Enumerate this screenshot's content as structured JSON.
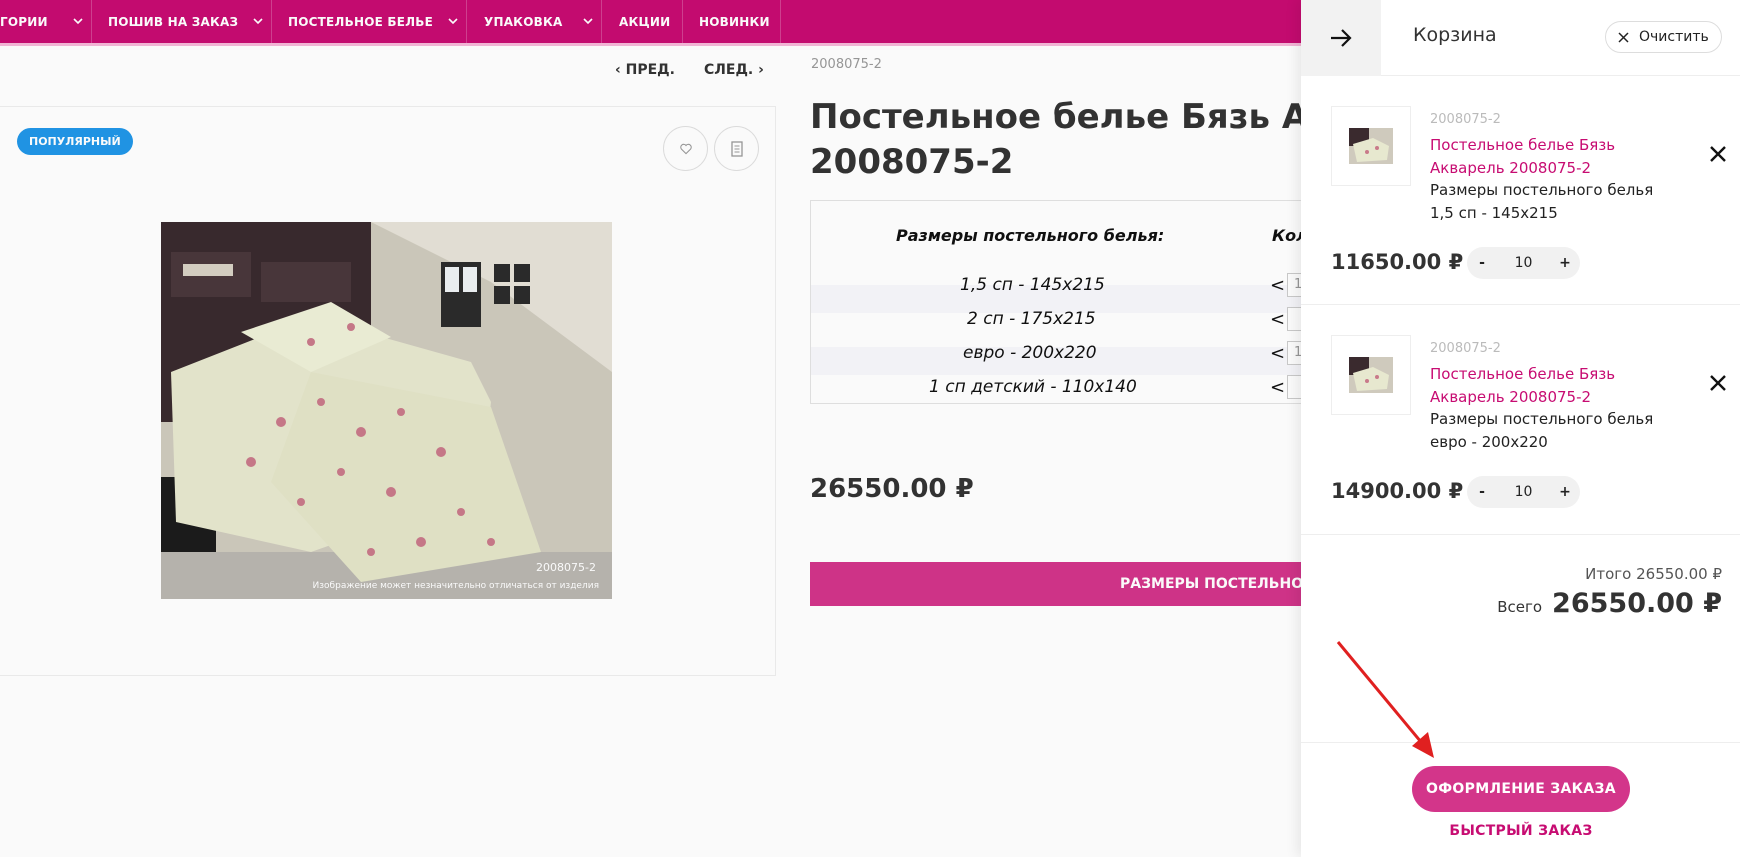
{
  "nav": {
    "items": [
      {
        "label": "ГОРИИ"
      },
      {
        "label": "ПОШИВ НА ЗАКАЗ"
      },
      {
        "label": "ПОСТЕЛЬНОЕ БЕЛЬЕ"
      },
      {
        "label": "УПАКОВКА"
      },
      {
        "label": "АКЦИИ"
      },
      {
        "label": "НОВИНКИ"
      }
    ]
  },
  "pager": {
    "prev": "‹ ПРЕД.",
    "next": "СЛЕД. ›"
  },
  "product": {
    "badge": "ПОПУЛЯРНЫЙ",
    "sku": "2008075-2",
    "title_line1": "Постельное белье Бязь Аква",
    "title_line2": "2008075-2",
    "image_caption": "2008075-2",
    "image_note": "Изображение может незначительно отличаться от изделия",
    "sizes_header": "Размеры постельного белья:",
    "qty_header": "Кол",
    "sizes": [
      {
        "name": "1,5 сп - 145х215",
        "lt": "<",
        "qty": "1"
      },
      {
        "name": "2 сп - 175х215",
        "lt": "<",
        "qty": ""
      },
      {
        "name": "евро - 200х220",
        "lt": "<",
        "qty": "1"
      },
      {
        "name": "1 сп детский - 110х140",
        "lt": "<",
        "qty": ""
      }
    ],
    "price": "26550.00 ₽",
    "sizes_button": "РАЗМЕРЫ ПОСТЕЛЬНОГО"
  },
  "cart": {
    "title": "Корзина",
    "clear_label": "Очистить",
    "items": [
      {
        "sku": "2008075-2",
        "name": "Постельное белье Бязь Акварель 2008075-2",
        "desc": "Размеры постельного белья 1,5 сп - 145х215",
        "price": "11650.00 ₽",
        "minus": "-",
        "qty": "10",
        "plus": "+"
      },
      {
        "sku": "2008075-2",
        "name": "Постельное белье Бязь Акварель 2008075-2",
        "desc": "Размеры постельного белья евро - 200х220",
        "price": "14900.00 ₽",
        "minus": "-",
        "qty": "10",
        "plus": "+"
      }
    ],
    "subtotal": "Итого 26550.00 ₽",
    "total_label": "Всего",
    "total_value": "26550.00 ₽",
    "checkout_button": "ОФОРМЛЕНИЕ ЗАКАЗА",
    "quick_order_button": "БЫСТРЫЙ ЗАКАЗ"
  },
  "colors": {
    "brand": "#c70c72",
    "button": "#d3358a",
    "badge": "#2196e8",
    "annotation_arrow": "#e02020"
  }
}
